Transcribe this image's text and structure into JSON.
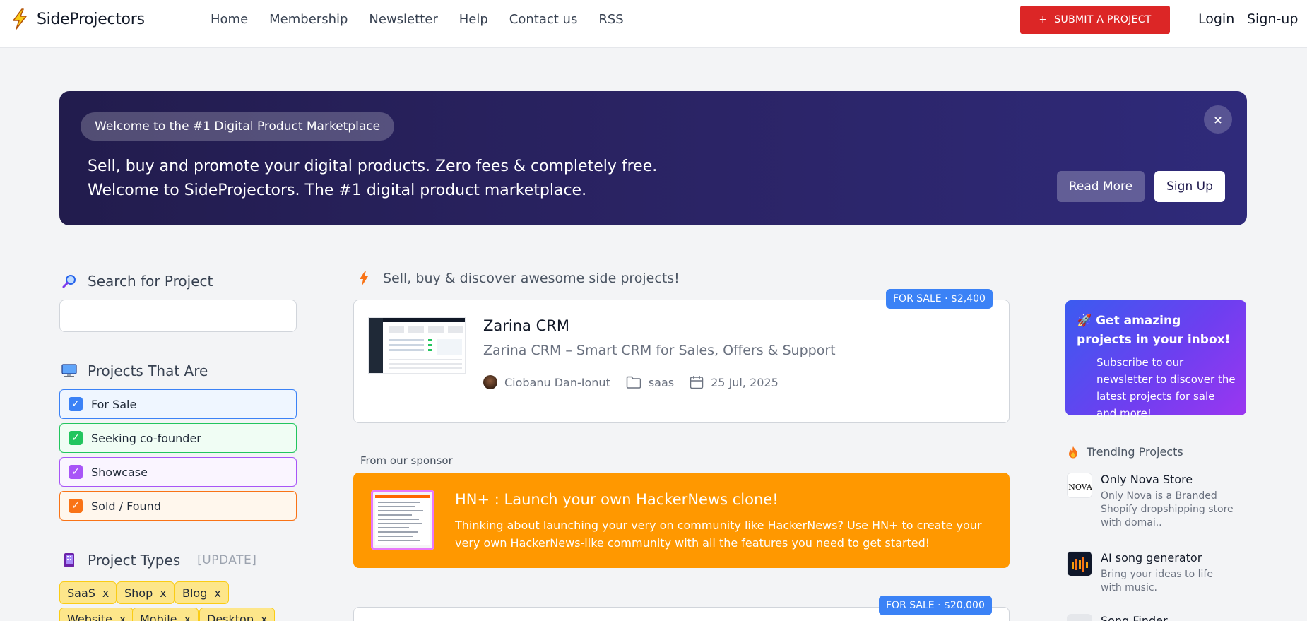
{
  "header": {
    "brand": "SideProjectors",
    "nav": [
      "Home",
      "Membership",
      "Newsletter",
      "Help",
      "Contact us",
      "RSS"
    ],
    "submit_label": "SUBMIT A PROJECT",
    "submit_icon": "+",
    "login": "Login",
    "signup": "Sign-up",
    "accent": "#dc2626"
  },
  "hero": {
    "pill": "Welcome to the #1 Digital Product Marketplace",
    "line1": "Sell, buy and promote your digital products. Zero fees & completely free.",
    "line2": "Welcome to SideProjectors. The #1 digital product marketplace.",
    "read_more": "Read More",
    "sign_up": "Sign Up",
    "close": "×"
  },
  "sidebar": {
    "search_title": "Search for Project",
    "search_placeholder": "",
    "filters_title": "Projects That Are",
    "filters": [
      {
        "label": "For Sale",
        "color": "#3b82f6"
      },
      {
        "label": "Seeking co-founder",
        "color": "#22c55e"
      },
      {
        "label": "Showcase",
        "color": "#a855f7"
      },
      {
        "label": "Sold / Found",
        "color": "#f97316"
      }
    ],
    "types_title": "Project Types",
    "types_update": "[UPDATE]",
    "types": [
      "SaaS",
      "Shop",
      "Blog",
      "Website",
      "Mobile",
      "Desktop"
    ],
    "chip_remove": "x"
  },
  "main": {
    "tagline": "Sell, buy & discover awesome side projects!",
    "projects": [
      {
        "badge": "FOR SALE · $2,400",
        "title": "Zarina CRM",
        "subtitle": "Zarina CRM – Smart CRM for Sales, Offers & Support",
        "author": "Ciobanu Dan-Ionut",
        "category": "saas",
        "date": "25 Jul, 2025"
      },
      {
        "badge": "FOR SALE · $20,000"
      }
    ],
    "sponsor_label": "From our sponsor",
    "sponsor": {
      "title": "HN+ : Launch your own HackerNews clone!",
      "desc": "Thinking about launching your very on community like HackerNews? Use HN+ to create your very own HackerNews-like community with all the features you need to get started!"
    }
  },
  "right": {
    "newsletter_title": "Get amazing projects in your inbox!",
    "newsletter_desc": "Subscribe to our newsletter to discover the latest projects for sale and more!",
    "trending_title": "Trending Projects",
    "trending": [
      {
        "title": "Only Nova Store",
        "desc": "Only Nova is a Branded Shopify dropshipping store with domai..",
        "logo_text": "NOVA"
      },
      {
        "title": "AI song generator",
        "desc": "Bring your ideas to life with music."
      },
      {
        "title": "Song Finder"
      }
    ]
  }
}
